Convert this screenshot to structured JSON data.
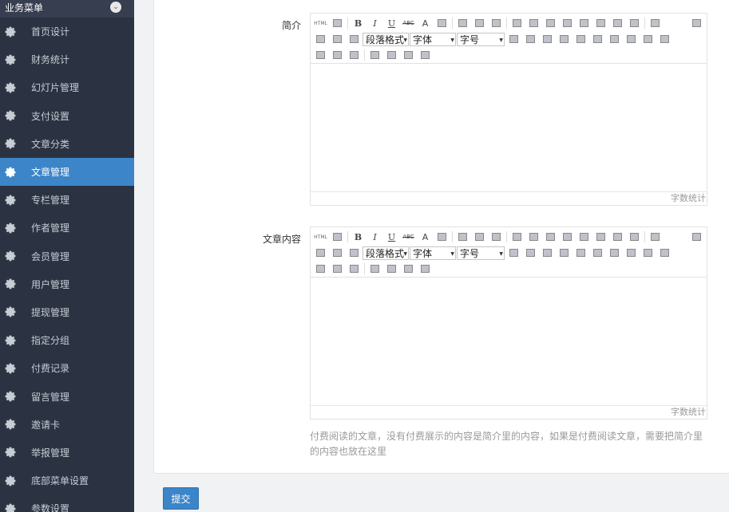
{
  "sidebar": {
    "header": "业务菜单",
    "toggle_icon": "chevron-down-icon",
    "active_color": "#3c85c8",
    "items": [
      {
        "label": "首页设计",
        "active": false
      },
      {
        "label": "财务统计",
        "active": false
      },
      {
        "label": "幻灯片管理",
        "active": false
      },
      {
        "label": "支付设置",
        "active": false
      },
      {
        "label": "文章分类",
        "active": false
      },
      {
        "label": "文章管理",
        "active": true
      },
      {
        "label": "专栏管理",
        "active": false
      },
      {
        "label": "作者管理",
        "active": false
      },
      {
        "label": "会员管理",
        "active": false
      },
      {
        "label": "用户管理",
        "active": false
      },
      {
        "label": "提现管理",
        "active": false
      },
      {
        "label": "指定分组",
        "active": false
      },
      {
        "label": "付费记录",
        "active": false
      },
      {
        "label": "留言管理",
        "active": false
      },
      {
        "label": "邀请卡",
        "active": false
      },
      {
        "label": "举报管理",
        "active": false
      },
      {
        "label": "底部菜单设置",
        "active": false
      },
      {
        "label": "参数设置",
        "active": false
      }
    ]
  },
  "form": {
    "summary_label": "简介",
    "content_label": "文章内容",
    "help_text": "付费阅读的文章，没有付费展示的内容是简介里的内容，如果是付费阅读文章，需要把简介里的内容也放在这里",
    "submit_label": "提交"
  },
  "editor": {
    "html_label": "HTML",
    "bold": "B",
    "italic": "I",
    "underline": "U",
    "strike": "ABC",
    "font_color": "A",
    "paragraph_select": "段落格式",
    "font_select": "字体",
    "size_select": "字号",
    "wordcount": "字数统计"
  }
}
